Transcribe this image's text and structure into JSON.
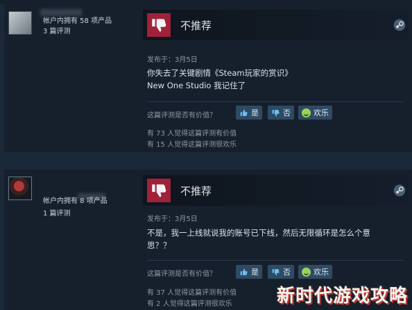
{
  "reviews": [
    {
      "user": {
        "owned": "帐户内拥有 58 项产品",
        "reviews": "3 篇评测"
      },
      "verdict": "不推荐",
      "posted": "发布于：3月5日",
      "lines": [
        "你失去了关键剧情《Steam玩家的赏识》",
        "New One Studio 我记住了"
      ],
      "helpful_question": "这篇评测是否有价值？",
      "buttons": {
        "yes": "是",
        "no": "否",
        "funny": "欢乐"
      },
      "helpful_count": "有 73 人觉得这篇评测有价值",
      "funny_count": "有 15 人觉得这篇评测很欢乐"
    },
    {
      "user": {
        "owned": "帐户内拥有 8 项产品",
        "reviews": "1 篇评测"
      },
      "verdict": "不推荐",
      "posted": "发布于：3月5日",
      "lines": [
        "不是，我一上线就说我的账号已下线，然后无限循环是怎么个意",
        "思？？"
      ],
      "helpful_question": "这篇评测是否有价值？",
      "buttons": {
        "yes": "是",
        "no": "否",
        "funny": "欢乐"
      },
      "helpful_count": "有 37 人觉得这篇评测有价值",
      "funny_count": "有 2 人觉得这篇评测很欢乐"
    }
  ],
  "watermark": "新时代游戏攻略",
  "icons": {
    "thumb": "thumbs-down-icon",
    "steam": "steam-logo-icon",
    "yes": "thumbs-up-icon",
    "no": "thumbs-down-icon",
    "funny": "smiley-icon"
  },
  "colors": {
    "background": "#1b2838",
    "panel": "#16202d",
    "thumb_box": "#a0213a",
    "button": "#2f4a63"
  }
}
